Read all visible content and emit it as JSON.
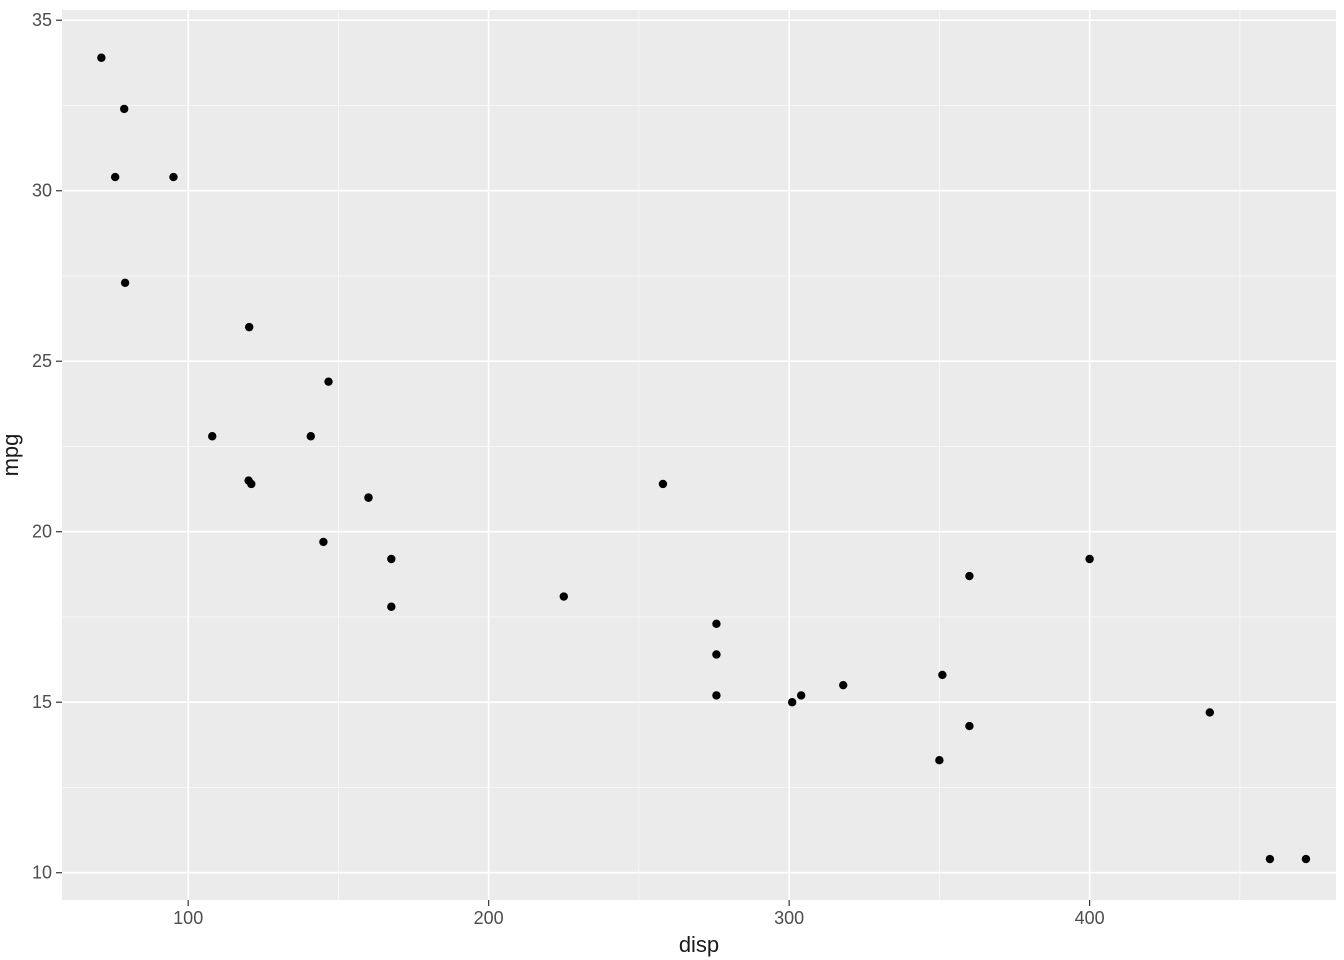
{
  "chart_data": {
    "type": "scatter",
    "xlabel": "disp",
    "ylabel": "mpg",
    "xlim": [
      58,
      482
    ],
    "ylim": [
      9.2,
      35.3
    ],
    "x_ticks": [
      100,
      200,
      300,
      400
    ],
    "y_ticks": [
      10,
      15,
      20,
      25,
      30,
      35
    ],
    "x_minor": [
      150,
      250,
      350,
      450
    ],
    "y_minor": [
      12.5,
      17.5,
      22.5,
      27.5,
      32.5
    ],
    "points": [
      {
        "x": 160,
        "y": 21.0
      },
      {
        "x": 160,
        "y": 21.0
      },
      {
        "x": 108,
        "y": 22.8
      },
      {
        "x": 258,
        "y": 21.4
      },
      {
        "x": 360,
        "y": 18.7
      },
      {
        "x": 225,
        "y": 18.1
      },
      {
        "x": 360,
        "y": 14.3
      },
      {
        "x": 146.7,
        "y": 24.4
      },
      {
        "x": 140.8,
        "y": 22.8
      },
      {
        "x": 167.6,
        "y": 19.2
      },
      {
        "x": 167.6,
        "y": 17.8
      },
      {
        "x": 275.8,
        "y": 16.4
      },
      {
        "x": 275.8,
        "y": 17.3
      },
      {
        "x": 275.8,
        "y": 15.2
      },
      {
        "x": 472,
        "y": 10.4
      },
      {
        "x": 460,
        "y": 10.4
      },
      {
        "x": 440,
        "y": 14.7
      },
      {
        "x": 78.7,
        "y": 32.4
      },
      {
        "x": 75.7,
        "y": 30.4
      },
      {
        "x": 71.1,
        "y": 33.9
      },
      {
        "x": 120.1,
        "y": 21.5
      },
      {
        "x": 318,
        "y": 15.5
      },
      {
        "x": 304,
        "y": 15.2
      },
      {
        "x": 350,
        "y": 13.3
      },
      {
        "x": 400,
        "y": 19.2
      },
      {
        "x": 79,
        "y": 27.3
      },
      {
        "x": 120.3,
        "y": 26.0
      },
      {
        "x": 95.1,
        "y": 30.4
      },
      {
        "x": 351,
        "y": 15.8
      },
      {
        "x": 145,
        "y": 19.7
      },
      {
        "x": 301,
        "y": 15.0
      },
      {
        "x": 121,
        "y": 21.4
      }
    ]
  }
}
